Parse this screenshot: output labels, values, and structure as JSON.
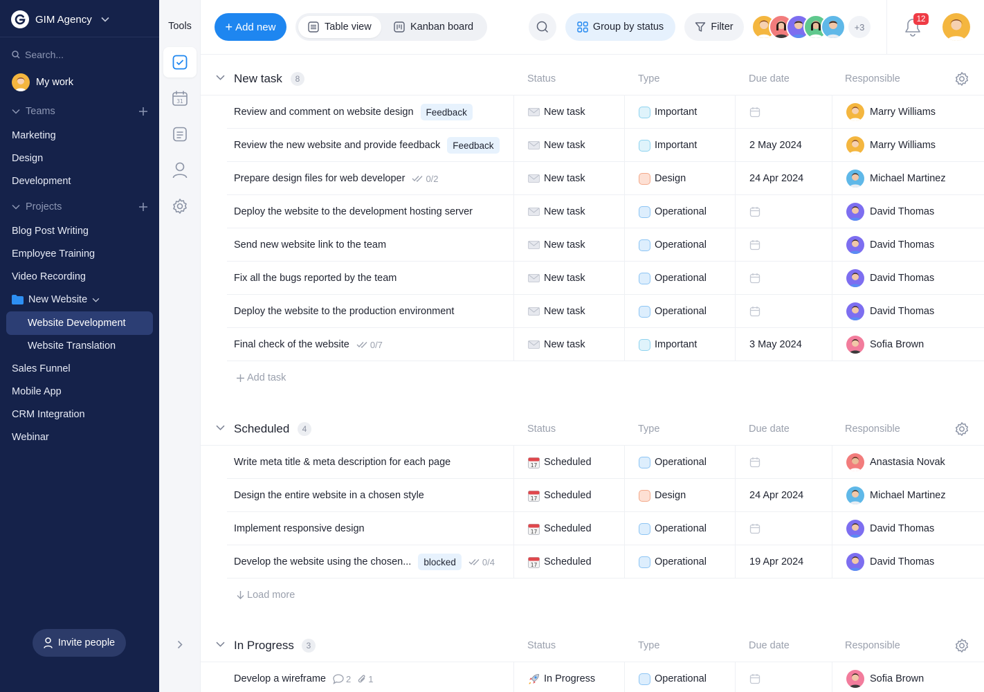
{
  "workspace": {
    "name": "GIM Agency"
  },
  "sidebar": {
    "search_placeholder": "Search...",
    "my_work": "My work",
    "teams_label": "Teams",
    "teams": [
      "Marketing",
      "Design",
      "Development"
    ],
    "projects_label": "Projects",
    "projects": [
      "Blog Post Writing",
      "Employee Training",
      "Video Recording"
    ],
    "folder": "New Website",
    "folder_items": [
      "Website Development",
      "Website Translation"
    ],
    "projects_more": [
      "Sales Funnel",
      "Mobile App",
      "CRM Integration",
      "Webinar"
    ],
    "invite": "Invite people"
  },
  "tools": {
    "title": "Tools"
  },
  "toolbar": {
    "add_new": "Add new",
    "table_view": "Table view",
    "kanban_board": "Kanban board",
    "group_by": "Group by status",
    "filter": "Filter",
    "more_members": "+3",
    "notifications": "12"
  },
  "columns": {
    "status": "Status",
    "type": "Type",
    "due": "Due date",
    "responsible": "Responsible"
  },
  "groups": [
    {
      "title": "New task",
      "count": "8",
      "footer": "Add task",
      "rows": [
        {
          "name": "Review and comment on website design",
          "tag": "Feedback",
          "subtasks": "",
          "status": "New task",
          "type": "Important",
          "due": "",
          "responsible": "Marry Williams"
        },
        {
          "name": "Review the new website and provide feedback",
          "tag": "Feedback",
          "subtasks": "",
          "status": "New task",
          "type": "Important",
          "due": "2 May 2024",
          "responsible": "Marry Williams"
        },
        {
          "name": "Prepare design files for web developer",
          "tag": "",
          "subtasks": "0/2",
          "status": "New task",
          "type": "Design",
          "due": "24 Apr 2024",
          "responsible": "Michael Martinez"
        },
        {
          "name": "Deploy the website to the development hosting server",
          "tag": "",
          "subtasks": "",
          "status": "New task",
          "type": "Operational",
          "due": "",
          "responsible": "David Thomas"
        },
        {
          "name": "Send new website link to the team",
          "tag": "",
          "subtasks": "",
          "status": "New task",
          "type": "Operational",
          "due": "",
          "responsible": "David Thomas"
        },
        {
          "name": "Fix all the bugs reported by the team",
          "tag": "",
          "subtasks": "",
          "status": "New task",
          "type": "Operational",
          "due": "",
          "responsible": "David Thomas"
        },
        {
          "name": "Deploy the website to the production environment",
          "tag": "",
          "subtasks": "",
          "status": "New task",
          "type": "Operational",
          "due": "",
          "responsible": "David Thomas"
        },
        {
          "name": "Final check of the website",
          "tag": "",
          "subtasks": "0/7",
          "status": "New task",
          "type": "Important",
          "due": "3 May 2024",
          "responsible": "Sofia Brown"
        }
      ]
    },
    {
      "title": "Scheduled",
      "count": "4",
      "footer": "Load more",
      "rows": [
        {
          "name": "Write meta title & meta description for each page",
          "tag": "",
          "subtasks": "",
          "status": "Scheduled",
          "type": "Operational",
          "due": "",
          "responsible": "Anastasia Novak"
        },
        {
          "name": "Design the entire website in a chosen style",
          "tag": "",
          "subtasks": "",
          "status": "Scheduled",
          "type": "Design",
          "due": "24 Apr 2024",
          "responsible": "Michael Martinez"
        },
        {
          "name": "Implement responsive design",
          "tag": "",
          "subtasks": "",
          "status": "Scheduled",
          "type": "Operational",
          "due": "",
          "responsible": "David Thomas"
        },
        {
          "name": "Develop the website using the chosen...",
          "tag": "blocked",
          "subtasks": "0/4",
          "status": "Scheduled",
          "type": "Operational",
          "due": "19 Apr 2024",
          "responsible": "David Thomas"
        }
      ]
    },
    {
      "title": "In Progress",
      "count": "3",
      "footer": "",
      "rows": [
        {
          "name": "Develop a wireframe",
          "tag": "",
          "subtasks": "",
          "comments": "2",
          "attachments": "1",
          "status": "In Progress",
          "type": "Operational",
          "due": "",
          "responsible": "Sofia Brown"
        }
      ]
    }
  ],
  "colors": {
    "sidebar_bg": "#15224a",
    "accent": "#1e86f0",
    "type_important": "#dff3fb",
    "type_design": "#fde0d4",
    "type_operational": "#ddeefd",
    "badge": "#ef3b45"
  }
}
